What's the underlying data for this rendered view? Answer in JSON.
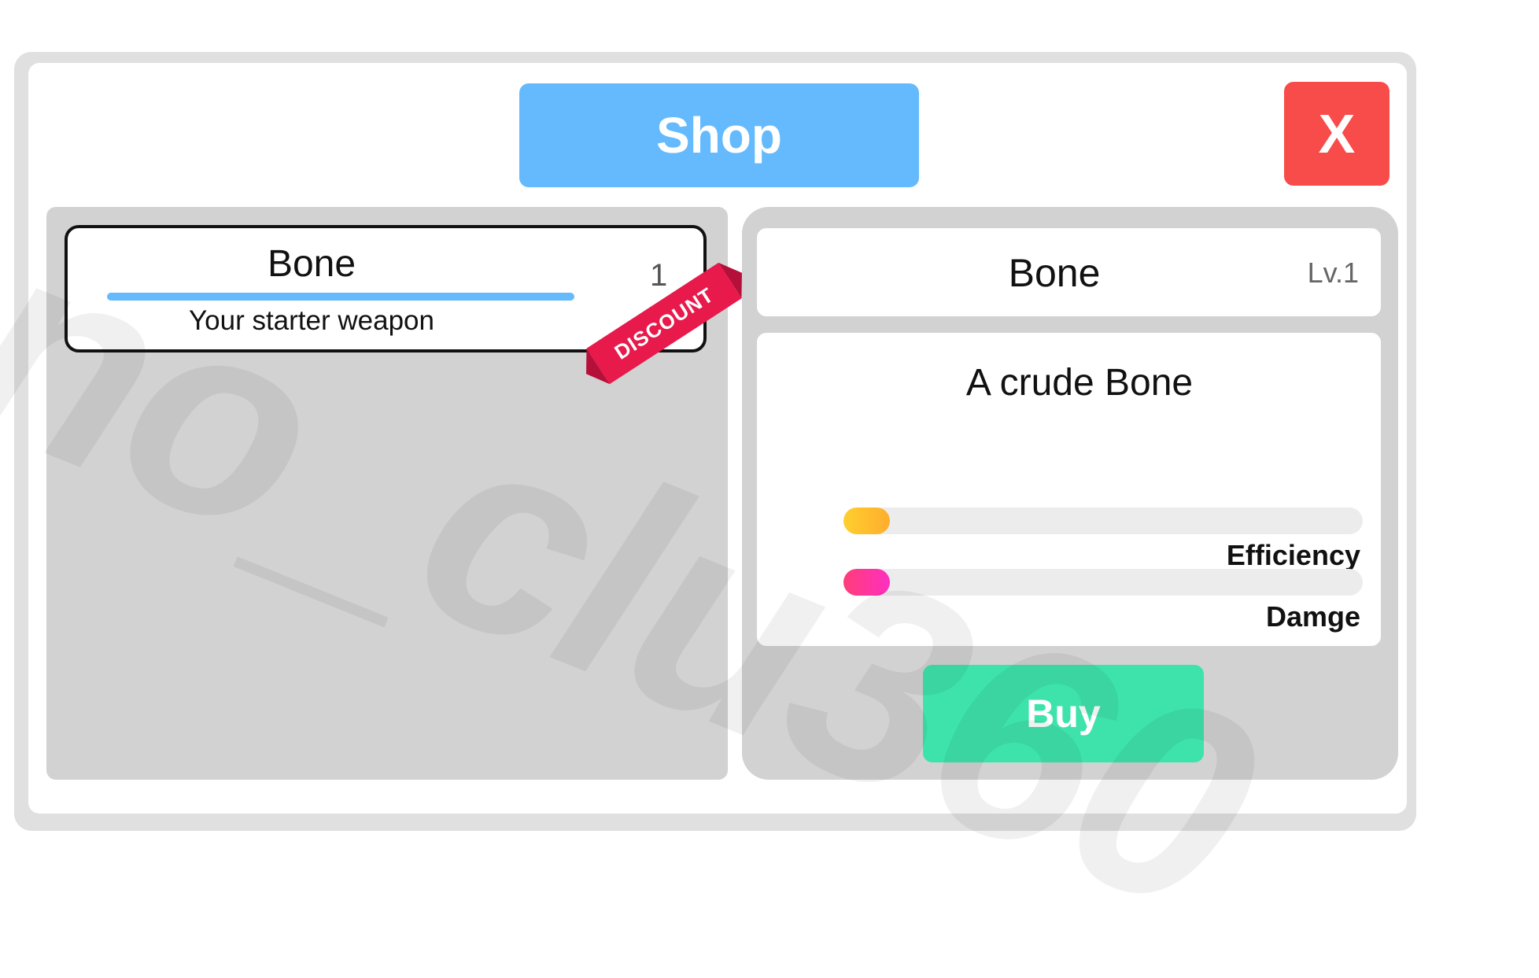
{
  "header": {
    "title": "Shop",
    "close_label": "X"
  },
  "items": [
    {
      "name": "Bone",
      "description": "Your starter weapon",
      "count": "1",
      "badge": "DISCOUNT",
      "progress": 0.8
    }
  ],
  "detail": {
    "name": "Bone",
    "level": "Lv.1",
    "description": "A crude Bone",
    "stats": [
      {
        "label": "Efficiency",
        "value": 0.09,
        "color_start": "#ffcf2e",
        "color_end": "#ffad2e"
      },
      {
        "label": "Damge",
        "value": 0.09,
        "color_start": "#ff3d78",
        "color_end": "#ff2fc0"
      }
    ],
    "buy_label": "Buy"
  },
  "watermark": "no_clu360",
  "colors": {
    "title_bg": "#64bafc",
    "close_bg": "#f84c4a",
    "buy_bg": "#3ee3ab",
    "ribbon": "#e8194b"
  }
}
